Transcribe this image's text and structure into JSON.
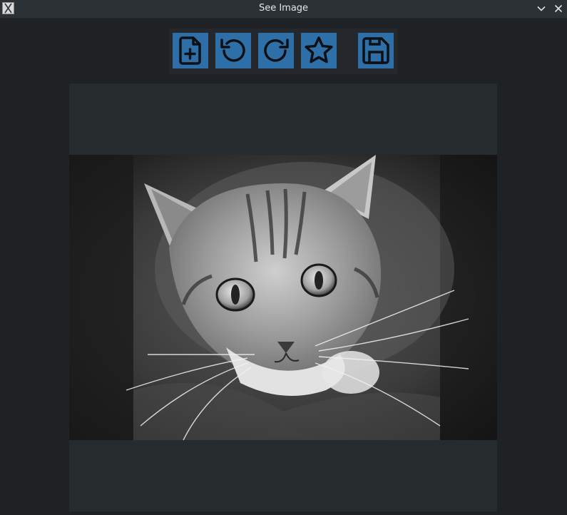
{
  "window": {
    "title": "See Image"
  },
  "titlebar_buttons": {
    "minimize_icon": "chevron-down-icon",
    "close_icon": "close-icon"
  },
  "toolbar": {
    "buttons": [
      {
        "name": "add-file",
        "icon": "file-plus-icon"
      },
      {
        "name": "rotate-left",
        "icon": "rotate-ccw-icon"
      },
      {
        "name": "rotate-right",
        "icon": "rotate-cw-icon"
      },
      {
        "name": "favorite",
        "icon": "star-icon"
      },
      {
        "name": "save",
        "icon": "save-icon"
      }
    ],
    "button_color": "#2f6fa8",
    "icon_color": "#0d1014"
  },
  "image": {
    "description_icon": "photo-cat-grayscale"
  }
}
